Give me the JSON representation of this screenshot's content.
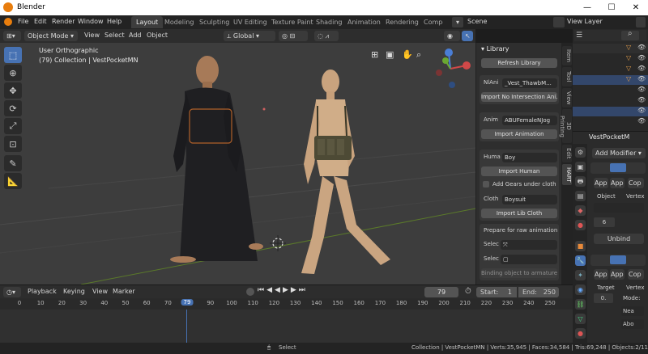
{
  "window": {
    "title": "Blender"
  },
  "menu": [
    "File",
    "Edit",
    "Render",
    "Window",
    "Help"
  ],
  "workspaces": [
    "Layout",
    "Modeling",
    "Sculpting",
    "UV Editing",
    "Texture Paint",
    "Shading",
    "Animation",
    "Rendering",
    "Compo"
  ],
  "scene": "Scene",
  "view_layer": "View Layer",
  "viewport_header": {
    "mode": "Object Mode",
    "menus": [
      "View",
      "Select",
      "Add",
      "Object"
    ],
    "orientation": "Global"
  },
  "viewport": {
    "view_name": "User Orthographic",
    "collection": "(79) Collection | VestPocketMN"
  },
  "npanel": {
    "header": "Library",
    "refresh_btn": "Refresh Library",
    "nlani_label": "NlAni",
    "nlani_value": "_Vest_ThawbM...",
    "import_no_intersection": "Import No Intersection Ani...",
    "anim_label": "Anim",
    "anim_value": "ABUFemaleNJog",
    "import_animation": "Import Animation",
    "human_label": "Huma",
    "human_value": "Boy",
    "import_human": "Import Human",
    "add_gears": "Add Gears under cloth",
    "cloth_label": "Cloth",
    "cloth_value": "Boysuit",
    "import_lib_cloth": "Import Lib Cloth",
    "prepare": "Prepare for raw animation",
    "select1": "Selec",
    "select2": "Selec",
    "binding": "Binding object to armature"
  },
  "vtabs": [
    "Item",
    "Tool",
    "View",
    "3D Printing",
    "Edit",
    "HART"
  ],
  "properties": {
    "object_name": "VestPocketM",
    "add_modifier": "Add Modifier",
    "apply": "App",
    "copy": "Cop",
    "object_label": "Object",
    "vertex_label": "Vertex",
    "count": "6",
    "unbind": "Unbind",
    "target_label": "Target",
    "zero": "0.",
    "mode_label": "Mode:",
    "nea": "Nea",
    "abo": "Abo"
  },
  "timeline": {
    "menus": [
      "Playback",
      "Keying",
      "View",
      "Marker"
    ],
    "current_frame": "79",
    "start_label": "Start:",
    "start": "1",
    "end_label": "End:",
    "end": "250",
    "ticks": [
      "0",
      "10",
      "20",
      "30",
      "40",
      "50",
      "60",
      "70",
      "79",
      "90",
      "100",
      "110",
      "120",
      "130",
      "140",
      "150",
      "160",
      "170",
      "180",
      "190",
      "200",
      "210",
      "220",
      "230",
      "240",
      "250"
    ]
  },
  "status": {
    "action": "Select",
    "stats": "Collection | VestPocketMN | Verts:35,945 | Faces:34,584 | Tris:69,248 | Objects:2/11 | Mer"
  },
  "colors": {
    "accent": "#4772b3",
    "active_frame": "#4772b3"
  }
}
